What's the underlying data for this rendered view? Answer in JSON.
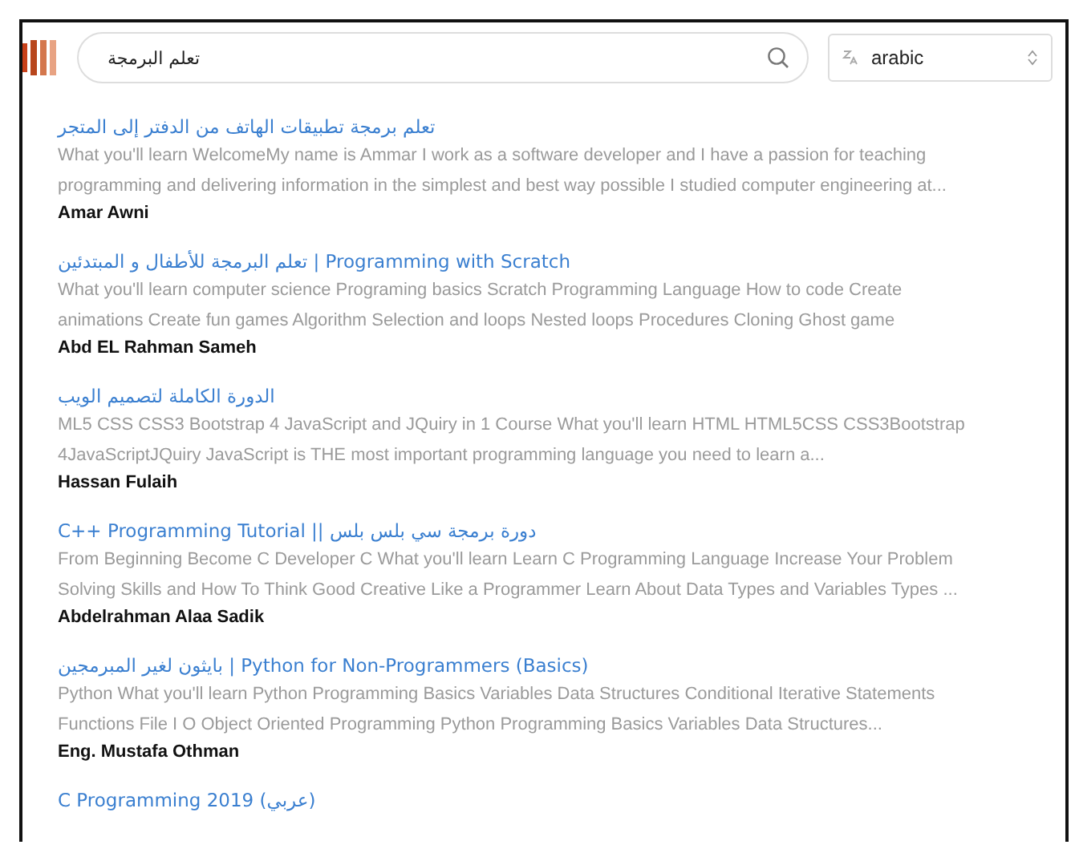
{
  "search": {
    "value": "تعلم البرمجة"
  },
  "language_select": {
    "value": "arabic"
  },
  "results": [
    {
      "title": "تعلم برمجة تطبيقات الهاتف من الدفتر إلى المتجر",
      "description": "What you'll learn WelcomeMy name is Ammar I work as a software developer and I have a passion for teaching programming and delivering information in the simplest and best way possible I studied computer engineering at...",
      "author": "Amar Awni"
    },
    {
      "title": "تعلم البرمجة للأطفال و المبتدئين | Programming with Scratch",
      "description": "What you'll learn computer science Programing basics Scratch Programming Language How to code Create animations Create fun games Algorithm Selection and loops Nested loops Procedures Cloning Ghost game",
      "author": "Abd EL Rahman Sameh"
    },
    {
      "title": "الدورة الكاملة لتصميم الويب",
      "description": "ML5 CSS CSS3 Bootstrap 4 JavaScript and JQuiry in 1 Course What you'll learn HTML HTML5CSS CSS3Bootstrap 4JavaScriptJQuiry JavaScript is THE most important programming language you need to learn a...",
      "author": "Hassan Fulaih"
    },
    {
      "title": "C++ Programming Tutorial || دورة برمجة سي بلس بلس",
      "description": "From Beginning Become C Developer C What you'll learn Learn C Programming Language Increase Your Problem Solving Skills and How To Think Good Creative Like a Programmer Learn About Data Types and Variables Types ...",
      "author": "Abdelrahman Alaa Sadik"
    },
    {
      "title": "بايثون لغير المبرمجين | Python for Non-Programmers (Basics)",
      "description": "Python What you'll learn Python Programming Basics Variables Data Structures Conditional Iterative Statements Functions File I O Object Oriented Programming Python Programming Basics Variables Data Structures...",
      "author": "Eng. Mustafa Othman"
    },
    {
      "title": "C Programming 2019 (عربي)"
    }
  ]
}
